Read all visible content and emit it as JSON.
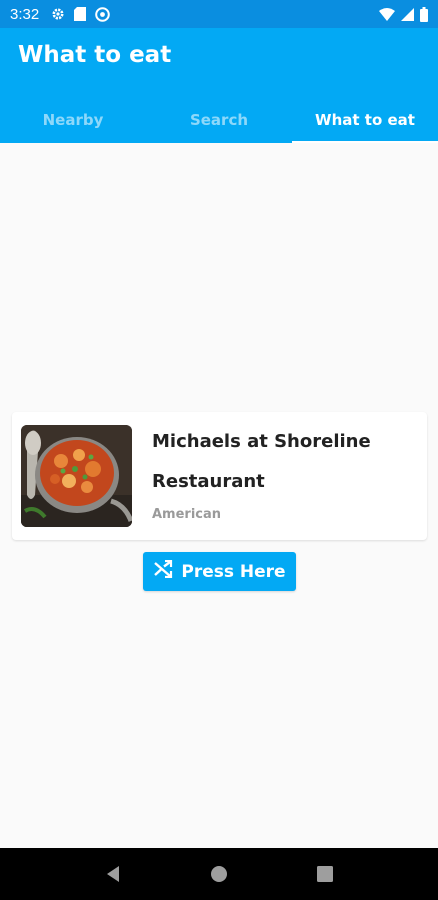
{
  "status_bar": {
    "time": "3:32",
    "left_icons": [
      "gear-icon",
      "sd-card-icon",
      "app-notification-icon"
    ],
    "right_icons": [
      "wifi-icon",
      "signal-icon",
      "battery-icon"
    ]
  },
  "app_bar": {
    "title": "What to eat"
  },
  "tabs": [
    {
      "label": "Nearby",
      "active": false
    },
    {
      "label": "Search",
      "active": false
    },
    {
      "label": "What to eat",
      "active": true
    }
  ],
  "restaurant": {
    "name": "Michaels at Shoreline Restaurant",
    "cuisine": "American"
  },
  "action_button": {
    "label": "Press Here",
    "icon": "shuffle-icon"
  },
  "nav": {
    "buttons": [
      "back-icon",
      "home-icon",
      "recents-icon"
    ]
  },
  "colors": {
    "status_bar": "#0a8ee0",
    "primary": "#03a9f4",
    "background": "#fafafa"
  }
}
